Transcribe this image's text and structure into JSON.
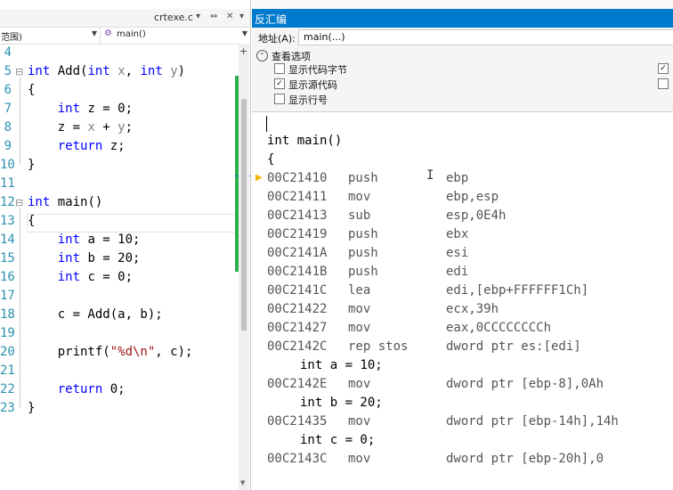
{
  "left_editor": {
    "tab_title": "crtexe.c",
    "tab_icons": [
      "dropdown-icon",
      "pin-icon",
      "close-icon",
      "menu-arrow-icon"
    ],
    "scope_dropdown": "范围)",
    "function_dropdown": "main()",
    "lines": [
      {
        "n": "4",
        "text": ""
      },
      {
        "n": "5",
        "text": "int Add(int x, int y)"
      },
      {
        "n": "6",
        "text": "{"
      },
      {
        "n": "7",
        "text": "    int z = 0;"
      },
      {
        "n": "8",
        "text": "    z = x + y;"
      },
      {
        "n": "9",
        "text": "    return z;"
      },
      {
        "n": "10",
        "text": "}"
      },
      {
        "n": "11",
        "text": ""
      },
      {
        "n": "12",
        "text": "int main()"
      },
      {
        "n": "13",
        "text": "{"
      },
      {
        "n": "14",
        "text": "    int a = 10;"
      },
      {
        "n": "15",
        "text": "    int b = 20;"
      },
      {
        "n": "16",
        "text": "    int c = 0;"
      },
      {
        "n": "17",
        "text": ""
      },
      {
        "n": "18",
        "text": "    c = Add(a, b);"
      },
      {
        "n": "19",
        "text": ""
      },
      {
        "n": "20",
        "text": "    printf(\"%d\\n\", c);"
      },
      {
        "n": "21",
        "text": ""
      },
      {
        "n": "22",
        "text": "    return 0;"
      },
      {
        "n": "23",
        "text": "}"
      }
    ]
  },
  "disassembly": {
    "title": "反汇编",
    "address_label": "地址(A):",
    "address_value": "main(...)",
    "options_header": "查看选项",
    "options": [
      {
        "label": "显示代码字节",
        "checked": false
      },
      {
        "label": "显示源代码",
        "checked": true
      },
      {
        "label": "显示行号",
        "checked": false
      }
    ],
    "options_right": [
      true,
      false
    ],
    "header_lines": [
      "int main()",
      "{"
    ],
    "instructions": [
      {
        "type": "asm",
        "addr": "00C21410",
        "mnemonic": "push",
        "operand": "ebp"
      },
      {
        "type": "asm",
        "addr": "00C21411",
        "mnemonic": "mov",
        "operand": "ebp,esp"
      },
      {
        "type": "asm",
        "addr": "00C21413",
        "mnemonic": "sub",
        "operand": "esp,0E4h"
      },
      {
        "type": "asm",
        "addr": "00C21419",
        "mnemonic": "push",
        "operand": "ebx"
      },
      {
        "type": "asm",
        "addr": "00C2141A",
        "mnemonic": "push",
        "operand": "esi"
      },
      {
        "type": "asm",
        "addr": "00C2141B",
        "mnemonic": "push",
        "operand": "edi"
      },
      {
        "type": "asm",
        "addr": "00C2141C",
        "mnemonic": "lea",
        "operand": "edi,[ebp+FFFFFF1Ch]"
      },
      {
        "type": "asm",
        "addr": "00C21422",
        "mnemonic": "mov",
        "operand": "ecx,39h"
      },
      {
        "type": "asm",
        "addr": "00C21427",
        "mnemonic": "mov",
        "operand": "eax,0CCCCCCCCh"
      },
      {
        "type": "asm",
        "addr": "00C2142C",
        "mnemonic": "rep stos",
        "operand": "dword ptr es:[edi]"
      },
      {
        "type": "src",
        "text": "int a = 10;"
      },
      {
        "type": "asm",
        "addr": "00C2142E",
        "mnemonic": "mov",
        "operand": "dword ptr [ebp-8],0Ah"
      },
      {
        "type": "src",
        "text": "int b = 20;"
      },
      {
        "type": "asm",
        "addr": "00C21435",
        "mnemonic": "mov",
        "operand": "dword ptr [ebp-14h],14h"
      },
      {
        "type": "src",
        "text": "int c = 0;"
      },
      {
        "type": "asm",
        "addr": "00C2143C",
        "mnemonic": "mov",
        "operand": "dword ptr [ebp-20h],0"
      }
    ]
  },
  "colors": {
    "title_bar": "#007acc",
    "keyword": "#0000ff",
    "line_number": "#2b91af",
    "change_bar": "#2db14f",
    "string": "#a31515"
  }
}
